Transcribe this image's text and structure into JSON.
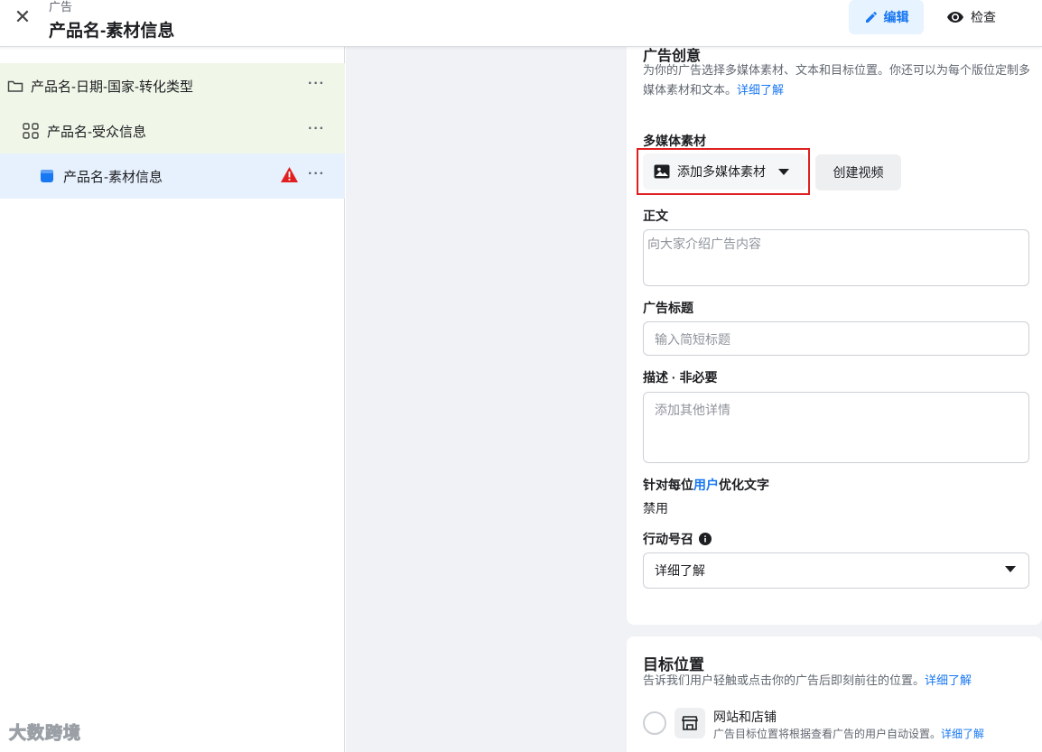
{
  "header": {
    "subtitle": "广告",
    "title": "产品名-素材信息",
    "edit_label": "编辑",
    "review_label": "检查"
  },
  "tree": {
    "items": [
      {
        "label": "产品名-日期-国家-转化类型",
        "icon": "folder-icon"
      },
      {
        "label": "产品名-受众信息",
        "icon": "grid-icon"
      },
      {
        "label": "产品名-素材信息",
        "icon": "ad-icon",
        "warning": true
      }
    ],
    "more": "···"
  },
  "creative": {
    "heading": "广告创意",
    "desc": "为你的广告选择多媒体素材、文本和目标位置。你还可以为每个版位定制多媒体素材和文本。",
    "learn_more": "详细了解",
    "media_label": "多媒体素材",
    "add_media_label": "添加多媒体素材",
    "create_video_label": "创建视频",
    "primary_text_label": "正文",
    "primary_text_placeholder": "向大家介绍广告内容",
    "headline_label": "广告标题",
    "headline_placeholder": "输入简短标题",
    "description_label": "描述 · 非必要",
    "description_placeholder": "添加其他详情",
    "optimize_prefix": "针对每位",
    "optimize_user": "用户",
    "optimize_suffix": "优化文字",
    "optimize_value": "禁用",
    "cta_label": "行动号召",
    "cta_value": "详细了解"
  },
  "destination": {
    "heading": "目标位置",
    "desc": "告诉我们用户轻触或点击你的广告后即刻前往的位置。",
    "learn_more": "详细了解",
    "option_title": "网站和店铺",
    "option_desc": "广告目标位置将根据查看广告的用户自动设置。",
    "option_learn_more": "详细了解"
  },
  "watermark": "大数跨境",
  "colors": {
    "accent": "#1877f2",
    "warning": "#e02020",
    "tree_green": "#f0f6e8",
    "tree_selected": "#e7f0fd"
  }
}
